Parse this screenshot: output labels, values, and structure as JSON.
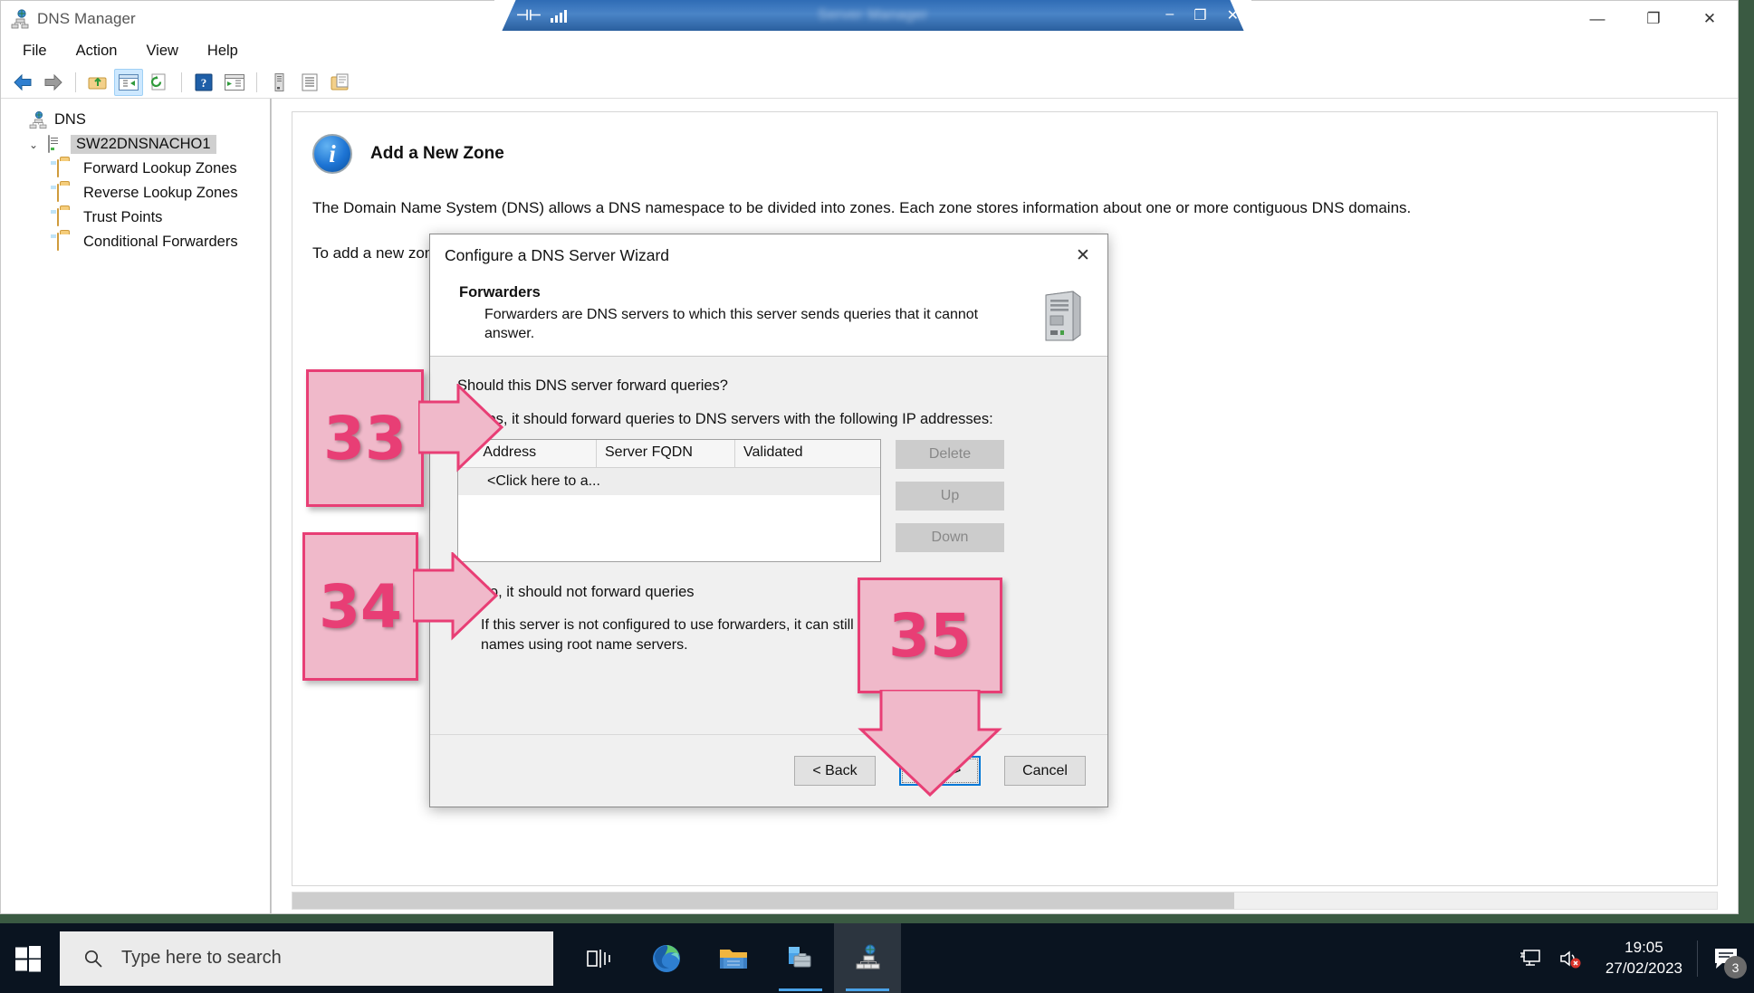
{
  "window": {
    "title": "DNS Manager",
    "title_icon": "dns-server-icon",
    "controls": {
      "minimize": "—",
      "maximize": "❐",
      "close": "✕"
    }
  },
  "menubar": {
    "items": [
      "File",
      "Action",
      "View",
      "Help"
    ]
  },
  "toolbar": {
    "buttons": [
      {
        "name": "back-arrow-icon",
        "glyph": "←"
      },
      {
        "name": "forward-arrow-icon",
        "glyph": "→"
      },
      {
        "name": "up-one-level-icon",
        "glyph": "↰"
      },
      {
        "name": "show-hide-console-tree-icon",
        "glyph": "▤",
        "active": true
      },
      {
        "name": "refresh-icon",
        "glyph": "↻"
      },
      {
        "name": "help-icon",
        "glyph": "?"
      },
      {
        "name": "export-list-icon",
        "glyph": "▶"
      },
      {
        "name": "new-server-icon",
        "glyph": "⌸"
      },
      {
        "name": "properties-icon",
        "glyph": "☰"
      },
      {
        "name": "new-zone-icon",
        "glyph": "❐"
      }
    ]
  },
  "tree": {
    "root": {
      "label": "DNS",
      "icon": "dns-root-icon"
    },
    "server": {
      "label": "SW22DNSNACHO1",
      "icon": "server-icon",
      "selected": true,
      "twisty": "⌄"
    },
    "children": [
      {
        "label": "Forward Lookup Zones",
        "icon": "folder-icon"
      },
      {
        "label": "Reverse Lookup Zones",
        "icon": "folder-icon"
      },
      {
        "label": "Trust Points",
        "icon": "folder-icon"
      },
      {
        "label": "Conditional Forwarders",
        "icon": "folder-icon"
      }
    ]
  },
  "details": {
    "icon": "info-icon",
    "heading": "Add a New Zone",
    "paragraph1": "The Domain Name System (DNS) allows a DNS namespace to be divided into zones. Each zone stores information about one or more contiguous DNS domains.",
    "paragraph2": "To add a new zone,"
  },
  "ghost_window": {
    "title": "Server Manager",
    "controls": {
      "minimize": "–",
      "maximize": "❐",
      "close": "✕"
    }
  },
  "wizard": {
    "title": "Configure a DNS Server Wizard",
    "close_glyph": "✕",
    "header": {
      "title": "Forwarders",
      "description": "Forwarders are DNS servers to which this server sends queries that it cannot answer.",
      "icon": "server-tower-icon"
    },
    "question": "Should this DNS server forward queries?",
    "option_yes": {
      "label": "Yes, it should forward queries to DNS servers with the following IP addresses:",
      "selected": false
    },
    "table": {
      "headers": [
        "IP Address",
        "Server FQDN",
        "Validated"
      ],
      "rows": [
        [
          "<Click here to a...",
          "",
          ""
        ]
      ]
    },
    "side_buttons": [
      {
        "label": "Delete",
        "enabled": false
      },
      {
        "label": "Up",
        "enabled": false
      },
      {
        "label": "Down",
        "enabled": false
      }
    ],
    "option_no": {
      "label": "No, it should not forward queries",
      "selected": true
    },
    "note": "If this server is not configured to use forwarders, it can still resolve names using root name servers.",
    "footer_buttons": [
      {
        "label": "< Back",
        "focused": false
      },
      {
        "label": "Next >",
        "focused": true
      },
      {
        "label": "Cancel",
        "focused": false
      }
    ]
  },
  "callouts": [
    {
      "number": "33",
      "name": "callout-33"
    },
    {
      "number": "34",
      "name": "callout-34"
    },
    {
      "number": "35",
      "name": "callout-35"
    }
  ],
  "colors": {
    "callout_fill": "#f0b9ca",
    "callout_border": "#e83e75",
    "callout_text": "#e83e75",
    "focus_blue": "#0078d7",
    "taskbar": "#0a1420",
    "selection_grey": "#cfcfcf"
  },
  "taskbar": {
    "start_label": "Start",
    "search_placeholder": "Type here to search",
    "search_icon": "search-icon",
    "apps": [
      {
        "name": "task-view-icon",
        "running": false
      },
      {
        "name": "microsoft-edge-icon",
        "running": false
      },
      {
        "name": "file-explorer-icon",
        "running": false
      },
      {
        "name": "server-manager-icon",
        "running": true
      },
      {
        "name": "dns-manager-icon",
        "running": true,
        "active": true
      }
    ],
    "tray": {
      "network_icon": "network-monitor-icon",
      "volume_icon": "volume-muted-icon",
      "time": "19:05",
      "date": "27/02/2023",
      "notifications_icon": "action-center-icon",
      "notification_count": "3"
    }
  }
}
